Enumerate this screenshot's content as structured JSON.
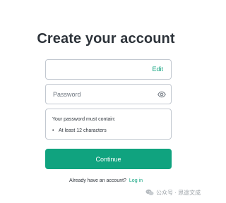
{
  "page": {
    "title": "Create your account"
  },
  "email_field": {
    "value": "",
    "edit_label": "Edit"
  },
  "password_field": {
    "placeholder": "Password",
    "icon": "eye-icon"
  },
  "password_rules": {
    "heading": "Your password must contain:",
    "items": [
      {
        "label": "At least 12 characters"
      }
    ]
  },
  "continue_button": {
    "label": "Continue"
  },
  "login_prompt": {
    "text": "Already have an account?",
    "link_label": "Log in"
  },
  "watermark": {
    "text": "公众号 · 思途文成"
  },
  "colors": {
    "accent": "#10a37f",
    "border": "#c2c8d0",
    "text": "#2d333a"
  }
}
